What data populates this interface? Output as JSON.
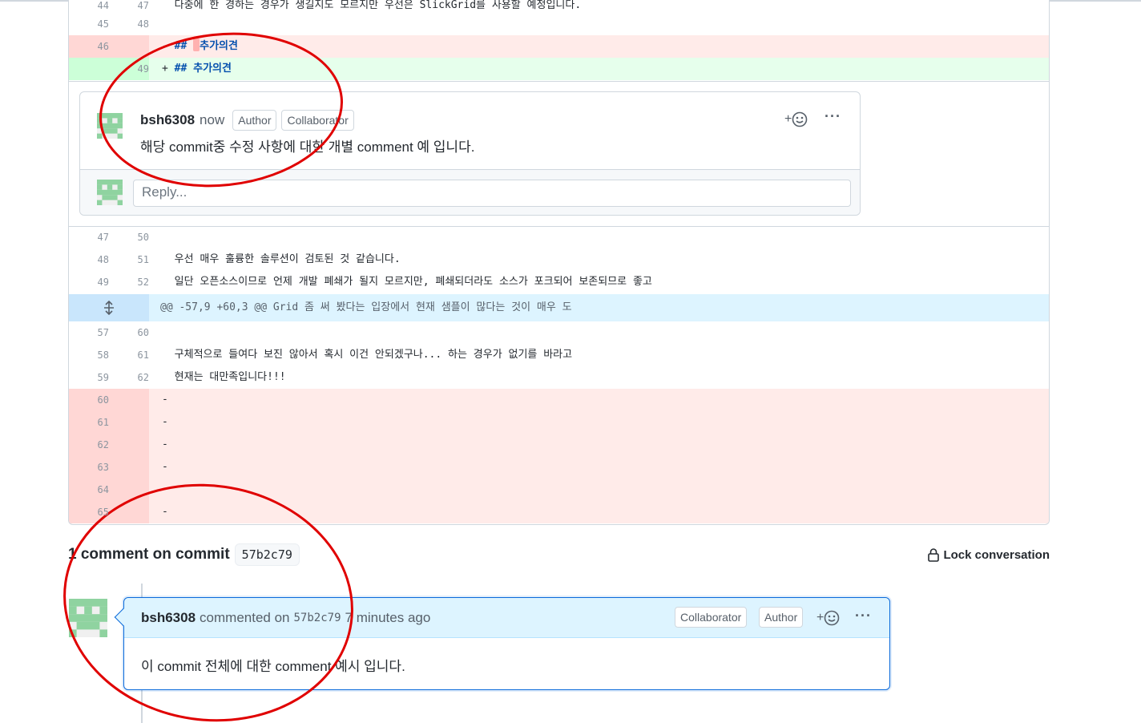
{
  "diff": {
    "rows_top": [
      {
        "a": "44",
        "b": "47",
        "type": "ctx",
        "text": "  다중에 한 경하는 경우가 생길지도 모르지만 우선은 SlickGrid를 사용할 예정입니다."
      },
      {
        "a": "45",
        "b": "48",
        "type": "ctx",
        "text": ""
      },
      {
        "a": "46",
        "b": "",
        "type": "del",
        "sign": "- ",
        "md": "## ",
        "text": "추가의견"
      },
      {
        "a": "",
        "b": "49",
        "type": "add",
        "sign": "+ ",
        "md": "## ",
        "text": "추가의견"
      }
    ],
    "rows_mid": [
      {
        "a": "47",
        "b": "50",
        "text": ""
      },
      {
        "a": "48",
        "b": "51",
        "text": "  우선 매우 훌륭한 솔루션이 검토된 것 같습니다."
      },
      {
        "a": "49",
        "b": "52",
        "text": "  일단 오픈소스이므로 언제 개발 폐쇄가 될지 모르지만, 폐쇄되더라도 소스가 포크되어 보존되므로 좋고"
      }
    ],
    "hunk_header": "@@ -57,9 +60,3 @@ Grid 좀 써 봤다는 입장에서 현재 샘플이 많다는 것이 매우 도",
    "rows_after": [
      {
        "a": "57",
        "b": "60",
        "text": ""
      },
      {
        "a": "58",
        "b": "61",
        "text": "  구체적으로 들여다 보진 않아서 혹시 이건 안되겠구나... 하는 경우가 없기를 바라고"
      },
      {
        "a": "59",
        "b": "62",
        "text": "  현재는 대만족입니다!!!"
      }
    ],
    "rows_deleted": [
      {
        "a": "60",
        "text": "-"
      },
      {
        "a": "61",
        "text": "-"
      },
      {
        "a": "62",
        "text": "-"
      },
      {
        "a": "63",
        "text": "-"
      },
      {
        "a": "64",
        "text": ""
      },
      {
        "a": "65",
        "text": "-"
      }
    ]
  },
  "inline_comment": {
    "author": "bsh6308",
    "time": "now",
    "badges": [
      "Author",
      "Collaborator"
    ],
    "body": "해당 commit중 수정 사항에 대한 개별 comment 예 입니다.",
    "reaction_label": "+",
    "reply_placeholder": "Reply..."
  },
  "commit_comments": {
    "title_count": "1",
    "title_text": "comment on commit",
    "sha": "57b2c79",
    "lock_label": "Lock conversation",
    "comment": {
      "author": "bsh6308",
      "verb": "commented on",
      "sha": "57b2c79",
      "time": "7 minutes ago",
      "badges": [
        "Collaborator",
        "Author"
      ],
      "reaction_label": "+",
      "body": "이 commit 전체에 대한 comment 예시 입니다."
    }
  },
  "colors": {
    "annotation": "#e00000",
    "accent": "#0969da",
    "deletion": "#ffebe9",
    "addition": "#e6ffec"
  }
}
